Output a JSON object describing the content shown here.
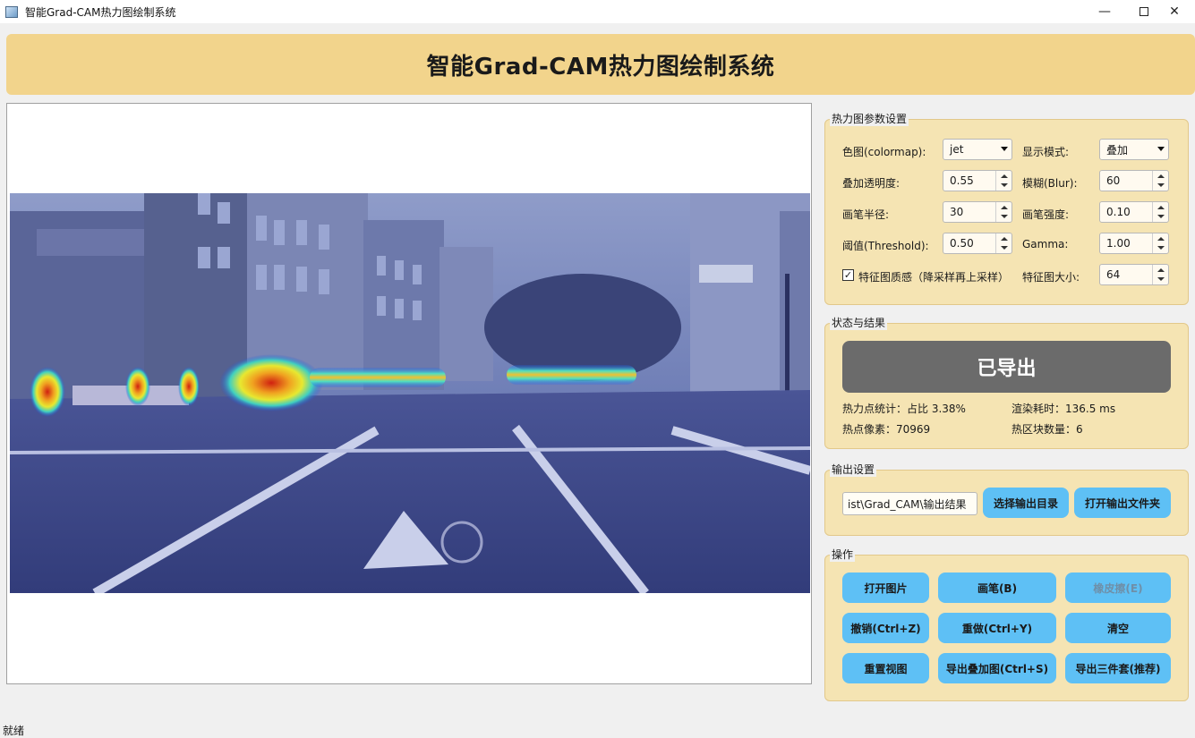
{
  "window": {
    "title": "智能Grad-CAM热力图绘制系统",
    "minimize_glyph": "—",
    "close_glyph": "✕"
  },
  "banner": {
    "title": "智能Grad-CAM热力图绘制系统"
  },
  "params": {
    "group_title": "热力图参数设置",
    "colormap_label": "色图(colormap):",
    "colormap_value": "jet",
    "display_mode_label": "显示模式:",
    "display_mode_value": "叠加",
    "alpha_label": "叠加透明度:",
    "alpha_value": "0.55",
    "blur_label": "模糊(Blur):",
    "blur_value": "60",
    "brush_radius_label": "画笔半径:",
    "brush_radius_value": "30",
    "brush_strength_label": "画笔强度:",
    "brush_strength_value": "0.10",
    "threshold_label": "阈值(Threshold):",
    "threshold_value": "0.50",
    "gamma_label": "Gamma:",
    "gamma_value": "1.00",
    "feature_quality_label": "特征图质感（降采样再上采样）",
    "feature_quality_checked": true,
    "feature_size_label": "特征图大小:",
    "feature_size_value": "64"
  },
  "status": {
    "group_title": "状态与结果",
    "status_text": "已导出",
    "hot_ratio": "热力点统计：占比 3.38%",
    "render_time": "渲染耗时：136.5 ms",
    "hot_pixels": "热点像素：70969",
    "hot_regions": "热区块数量：6"
  },
  "output": {
    "group_title": "输出设置",
    "path_value": "ist\\Grad_CAM\\输出结果",
    "choose_dir_label": "选择输出目录",
    "open_dir_label": "打开输出文件夹"
  },
  "actions": {
    "group_title": "操作",
    "open_image": "打开图片",
    "brush": "画笔(B)",
    "eraser": "橡皮擦(E)",
    "undo": "撤销(Ctrl+Z)",
    "redo": "重做(Ctrl+Y)",
    "clear": "清空",
    "reset_view": "重置视图",
    "export_overlay": "导出叠加图(Ctrl+S)",
    "export_three": "导出三件套(推荐)"
  },
  "statusbar": {
    "text": "就绪"
  },
  "colors": {
    "banner": "#f2d48c",
    "panel": "#f5e4b3",
    "button": "#5ec0f5",
    "status_button": "#6b6b6b"
  }
}
